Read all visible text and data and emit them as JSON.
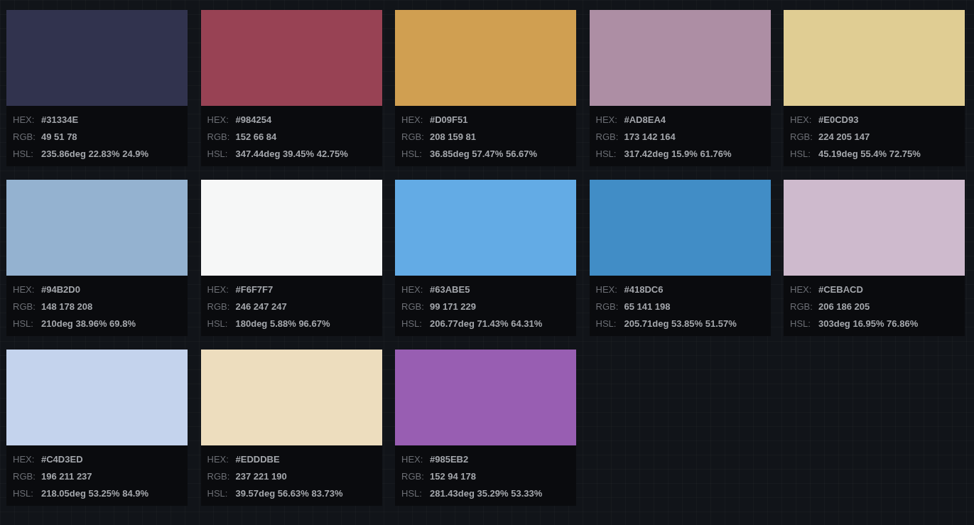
{
  "swatches": [
    {
      "color": "#31334e",
      "rows": [
        {
          "label": "HEX:",
          "value": "#31334E"
        },
        {
          "label": "RGB:",
          "value": "49 51 78"
        },
        {
          "label": "HSL:",
          "value": "235.86deg 22.83% 24.9%"
        }
      ]
    },
    {
      "color": "#984254",
      "rows": [
        {
          "label": "HEX:",
          "value": "#984254"
        },
        {
          "label": "RGB:",
          "value": "152 66 84"
        },
        {
          "label": "HSL:",
          "value": "347.44deg 39.45% 42.75%"
        }
      ]
    },
    {
      "color": "#d09f51",
      "rows": [
        {
          "label": "HEX:",
          "value": "#D09F51"
        },
        {
          "label": "RGB:",
          "value": "208 159 81"
        },
        {
          "label": "HSL:",
          "value": "36.85deg 57.47% 56.67%"
        }
      ]
    },
    {
      "color": "#ad8ea4",
      "rows": [
        {
          "label": "HEX:",
          "value": "#AD8EA4"
        },
        {
          "label": "RGB:",
          "value": "173 142 164"
        },
        {
          "label": "HSL:",
          "value": "317.42deg 15.9% 61.76%"
        }
      ]
    },
    {
      "color": "#e0cd93",
      "rows": [
        {
          "label": "HEX:",
          "value": "#E0CD93"
        },
        {
          "label": "RGB:",
          "value": "224 205 147"
        },
        {
          "label": "HSL:",
          "value": "45.19deg 55.4% 72.75%"
        }
      ]
    },
    {
      "color": "#94b2d0",
      "rows": [
        {
          "label": "HEX:",
          "value": "#94B2D0"
        },
        {
          "label": "RGB:",
          "value": "148 178 208"
        },
        {
          "label": "HSL:",
          "value": "210deg 38.96% 69.8%"
        }
      ]
    },
    {
      "color": "#f6f7f7",
      "rows": [
        {
          "label": "HEX:",
          "value": "#F6F7F7"
        },
        {
          "label": "RGB:",
          "value": "246 247 247"
        },
        {
          "label": "HSL:",
          "value": "180deg 5.88% 96.67%"
        }
      ]
    },
    {
      "color": "#63abe5",
      "rows": [
        {
          "label": "HEX:",
          "value": "#63ABE5"
        },
        {
          "label": "RGB:",
          "value": "99 171 229"
        },
        {
          "label": "HSL:",
          "value": "206.77deg 71.43% 64.31%"
        }
      ]
    },
    {
      "color": "#418dc6",
      "rows": [
        {
          "label": "HEX:",
          "value": "#418DC6"
        },
        {
          "label": "RGB:",
          "value": "65 141 198"
        },
        {
          "label": "HSL:",
          "value": "205.71deg 53.85% 51.57%"
        }
      ]
    },
    {
      "color": "#cebacd",
      "rows": [
        {
          "label": "HEX:",
          "value": "#CEBACD"
        },
        {
          "label": "RGB:",
          "value": "206 186 205"
        },
        {
          "label": "HSL:",
          "value": "303deg 16.95% 76.86%"
        }
      ]
    },
    {
      "color": "#c4d3ed",
      "rows": [
        {
          "label": "HEX:",
          "value": "#C4D3ED"
        },
        {
          "label": "RGB:",
          "value": "196 211 237"
        },
        {
          "label": "HSL:",
          "value": "218.05deg 53.25% 84.9%"
        }
      ]
    },
    {
      "color": "#edddbe",
      "rows": [
        {
          "label": "HEX:",
          "value": "#EDDDBE"
        },
        {
          "label": "RGB:",
          "value": "237 221 190"
        },
        {
          "label": "HSL:",
          "value": "39.57deg 56.63% 83.73%"
        }
      ]
    },
    {
      "color": "#985eb2",
      "rows": [
        {
          "label": "HEX:",
          "value": "#985EB2"
        },
        {
          "label": "RGB:",
          "value": "152 94 178"
        },
        {
          "label": "HSL:",
          "value": "281.43deg 35.29% 53.33%"
        }
      ]
    }
  ]
}
